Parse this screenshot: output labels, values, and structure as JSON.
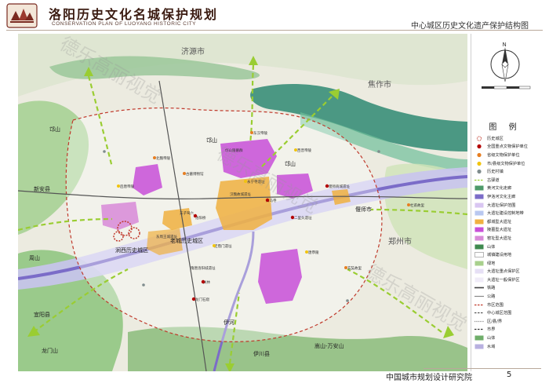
{
  "header": {
    "title": "洛阳历史文化名城保护规划",
    "subtitle": "CONSERVATION PLAN OF LUOYANG HISTORIC CITY",
    "map_title": "中心城区历史文化遗产保护结构图"
  },
  "watermark": {
    "text": "德乐高丽视觉"
  },
  "legend": {
    "title": "图 例",
    "items": [
      {
        "label": "历史城区",
        "color": "#c0392b",
        "kind": "dot-ring"
      },
      {
        "label": "全国重点文物保护单位",
        "color": "#b30000",
        "kind": "dot"
      },
      {
        "label": "省级文物保护单位",
        "color": "#e67e22",
        "kind": "dot"
      },
      {
        "label": "市/县级文物保护单位",
        "color": "#f1c40f",
        "kind": "dot"
      },
      {
        "label": "历史村镇",
        "color": "#7f8c8d",
        "kind": "dot"
      },
      {
        "label": "古驿道",
        "color": "#9acd32",
        "kind": "dash"
      },
      {
        "label": "黄河文化走廊",
        "color": "#4e9a6a",
        "kind": "rect"
      },
      {
        "label": "伊洛河文化主廊",
        "color": "#7b6cc8",
        "kind": "rect"
      },
      {
        "label": "大遗址保护范围",
        "color": "#d9c6f2",
        "kind": "rect"
      },
      {
        "label": "大遗址建设控制地带",
        "color": "#b9c8f0",
        "kind": "rect"
      },
      {
        "label": "都城型大遗址",
        "color": "#f0b040",
        "kind": "rect"
      },
      {
        "label": "陵墓型大遗址",
        "color": "#c84fd8",
        "kind": "rect"
      },
      {
        "label": "窑址型大遗址",
        "color": "#d88ad8",
        "kind": "rect"
      },
      {
        "label": "山体",
        "color": "#3f8a4f",
        "kind": "rect"
      },
      {
        "label": "城镇建设用地",
        "color": "#ffffff",
        "kind": "rect-outline"
      },
      {
        "label": "绿地",
        "color": "#a8d08d",
        "kind": "rect"
      },
      {
        "label": "大遗址重点保护区",
        "color": "#e6e0f5",
        "kind": "rect"
      },
      {
        "label": "大遗址一般保护区",
        "color": "#f0ecf8",
        "kind": "rect"
      },
      {
        "label": "铁路",
        "color": "#444444",
        "kind": "rail"
      },
      {
        "label": "公路",
        "color": "#888888",
        "kind": "line"
      },
      {
        "label": "市区范围",
        "color": "#c0392b",
        "kind": "dash"
      },
      {
        "label": "中心城区范围",
        "color": "#555555",
        "kind": "dash"
      },
      {
        "label": "区/县/界",
        "color": "#777777",
        "kind": "dot-line"
      },
      {
        "label": "市界",
        "color": "#333333",
        "kind": "dash"
      },
      {
        "label": "山体",
        "color": "#6fae6a",
        "kind": "rect"
      },
      {
        "label": "水域",
        "color": "#b8b0e0",
        "kind": "rect"
      }
    ]
  },
  "map": {
    "place_labels": [
      {
        "text": "济源市",
        "size": "big"
      },
      {
        "text": "焦作市",
        "size": "big"
      },
      {
        "text": "郑州市",
        "size": "big"
      },
      {
        "text": "老城历史城区",
        "size": "mid"
      },
      {
        "text": "涧西历史城区",
        "size": "mid"
      },
      {
        "text": "邙山",
        "size": "mid"
      },
      {
        "text": "邙山",
        "size": "mid"
      },
      {
        "text": "邙山",
        "size": "mid"
      },
      {
        "text": "新安县",
        "size": "mid"
      },
      {
        "text": "周山",
        "size": "mid"
      },
      {
        "text": "龙门山",
        "size": "mid"
      },
      {
        "text": "嵩山-万安山",
        "size": "mid"
      },
      {
        "text": "伊河",
        "size": "mid"
      },
      {
        "text": "宜阳县",
        "size": "mid"
      },
      {
        "text": "伊川县",
        "size": "mid"
      },
      {
        "text": "偃师市",
        "size": "mid"
      }
    ],
    "site_labels": [
      "汉魏故城遗址",
      "东周王城遗址",
      "隋唐洛阳城遗址",
      "二里头遗址",
      "偃师商城遗址",
      "邙山陵墓群",
      "龙门石窟",
      "白马寺",
      "关林",
      "洛阳桥",
      "古墓博物馆",
      "玄奘故里",
      "杜甫故里",
      "北魏帝陵",
      "东汉帝陵",
      "后唐帝陵",
      "唐恭陵",
      "西晋帝陵",
      "天子驾六",
      "定鼎门遗址",
      "永宁寺遗址"
    ]
  },
  "footer": {
    "org": "中国城市规划设计研究院",
    "page": "5"
  }
}
